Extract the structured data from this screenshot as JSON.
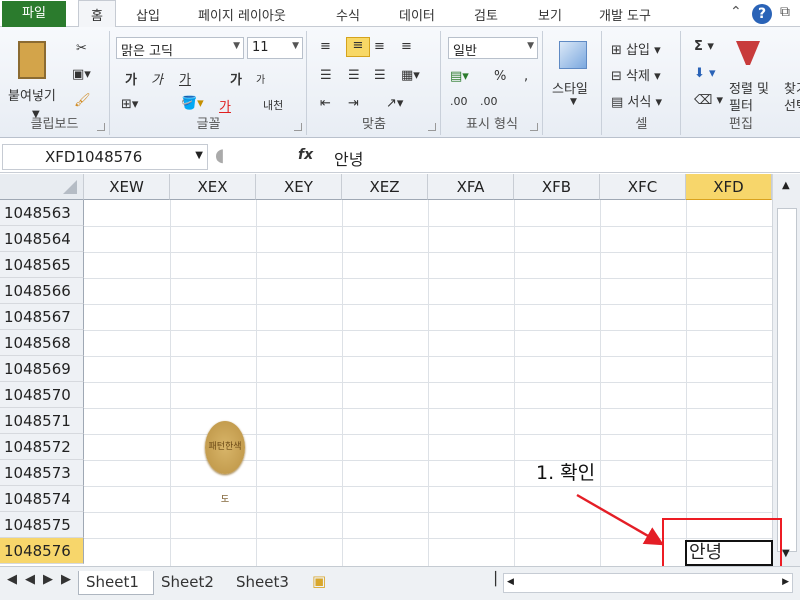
{
  "ribbon": {
    "tabs": [
      "파일",
      "홈",
      "삽입",
      "페이지 레이아웃",
      "수식",
      "데이터",
      "검토",
      "보기",
      "개발 도구"
    ],
    "groups": [
      "클립보드",
      "글꼴",
      "맞춤",
      "표시 형식",
      "셀",
      "편집"
    ],
    "clipboard": {
      "paste": "붙여넣기"
    },
    "font": {
      "name": "맑은 고딕",
      "size": "11",
      "bold": "가",
      "italic": "가",
      "underline": "가",
      "grow": "가",
      "shrink": "가",
      "color": "가",
      "phonetic": "내천"
    },
    "number": {
      "format": "일반",
      "percent": "%",
      "comma": ","
    },
    "styles": {
      "label": "스타일"
    },
    "cells": {
      "insert": "삽입",
      "delete": "삭제",
      "format": "서식"
    },
    "editing": {
      "sort": "정렬 및 필터",
      "find": "찾기 및 선택"
    }
  },
  "formula": {
    "name_box": "XFD1048576",
    "fx": "fx",
    "value": "안녕"
  },
  "columns": [
    "XEW",
    "XEX",
    "XEY",
    "XEZ",
    "XFA",
    "XFB",
    "XFC",
    "XFD"
  ],
  "rows": [
    "1048563",
    "1048564",
    "1048565",
    "1048566",
    "1048567",
    "1048568",
    "1048569",
    "1048570",
    "1048571",
    "1048572",
    "1048573",
    "1048574",
    "1048575",
    "1048576"
  ],
  "active_cell": {
    "text": "안녕",
    "column": "XFD",
    "row": "1048576"
  },
  "annotation": {
    "text": "1. 확인"
  },
  "sheets": [
    "Sheet1",
    "Sheet2",
    "Sheet3"
  ],
  "seal": {
    "text": "패턴한색도"
  }
}
